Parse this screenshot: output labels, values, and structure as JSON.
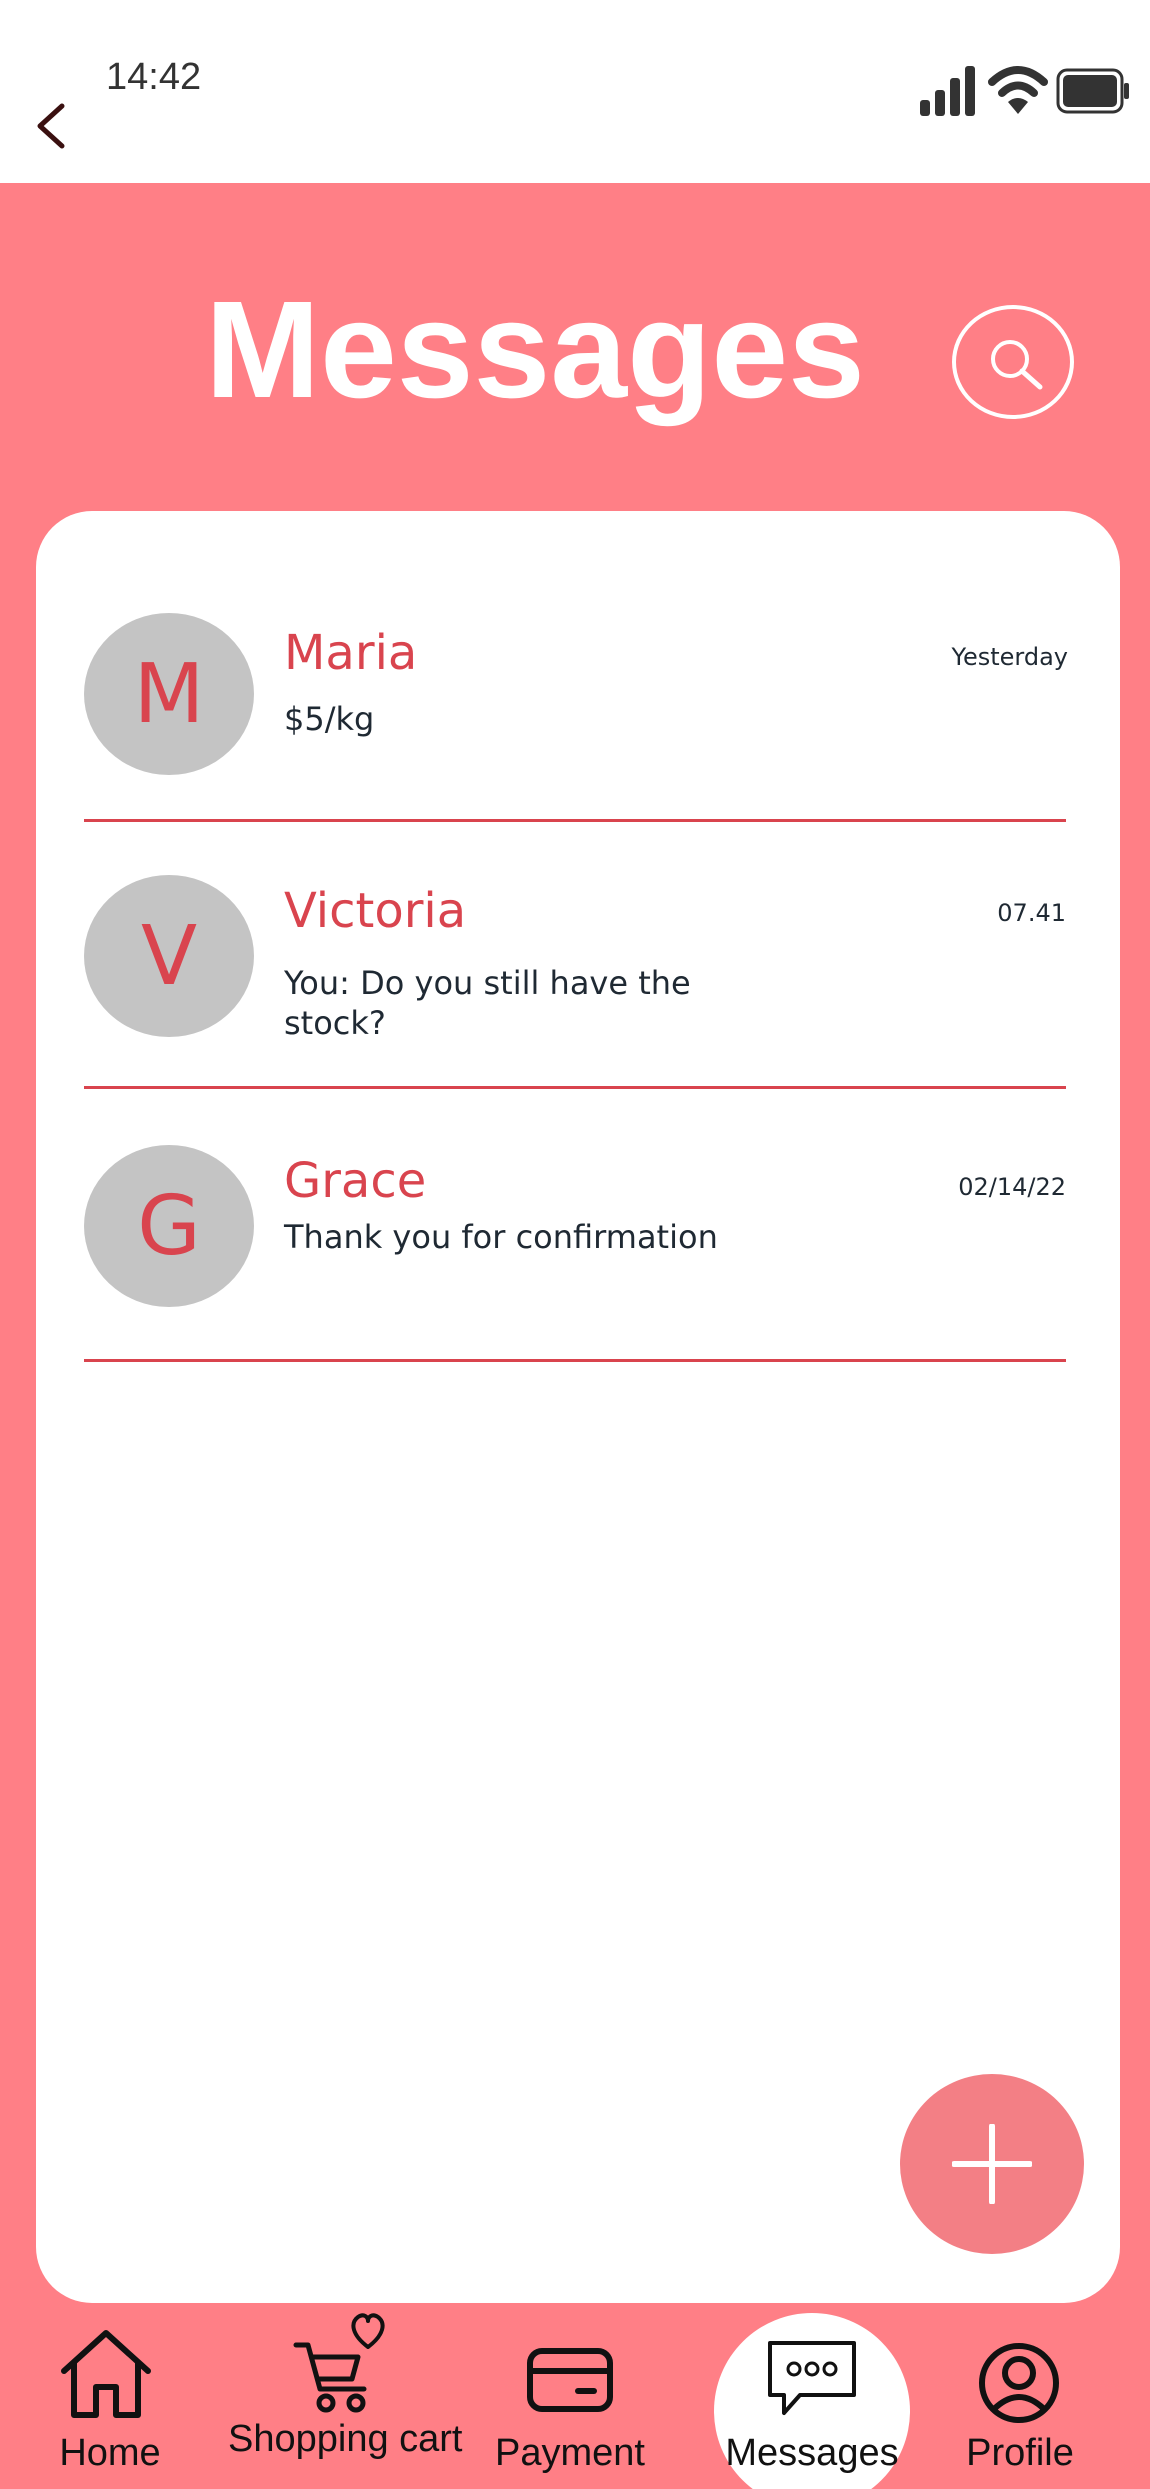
{
  "status_bar": {
    "time": "14:42",
    "icons": [
      "back-arrow-icon",
      "signal-icon",
      "wifi-icon",
      "battery-icon"
    ]
  },
  "header": {
    "title": "Messages",
    "search_icon": "search-icon",
    "background_color": "#FF7F86"
  },
  "conversations": [
    {
      "initial": "M",
      "name": "Maria",
      "preview": "$5/kg",
      "time": "Yesterday"
    },
    {
      "initial": "V",
      "name": "Victoria",
      "preview": "You: Do you still have the stock?",
      "time": "07.41"
    },
    {
      "initial": "G",
      "name": "Grace",
      "preview": "Thank you for confirmation",
      "time": "02/14/22"
    }
  ],
  "fab": {
    "icon": "plus-icon",
    "color": "#F37F85"
  },
  "bottom_nav": {
    "active": "Messages",
    "items": [
      {
        "label": "Home",
        "icon": "home-icon"
      },
      {
        "label": "Shopping cart",
        "icon": "cart-heart-icon"
      },
      {
        "label": "Payment",
        "icon": "card-icon"
      },
      {
        "label": "Messages",
        "icon": "chat-icon"
      },
      {
        "label": "Profile",
        "icon": "profile-icon"
      }
    ]
  },
  "colors": {
    "accent_red": "#D9444E",
    "avatar_grey": "#C4C4C4",
    "text_dark": "#1F2933"
  }
}
